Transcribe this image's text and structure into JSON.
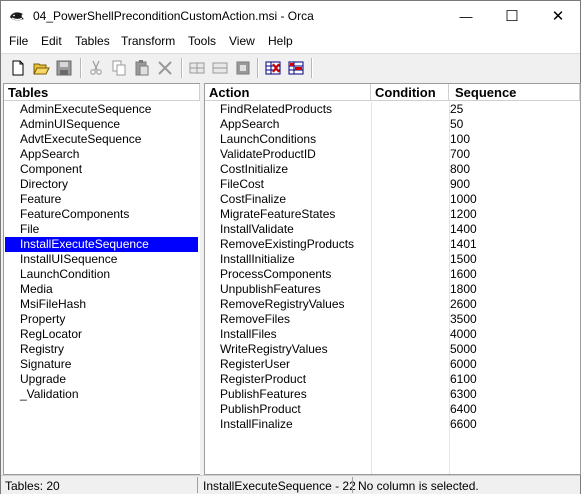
{
  "window": {
    "title": "04_PowerShellPreconditionCustomAction.msi - Orca",
    "controls": {
      "minimize": "—",
      "maximize": "☐",
      "close": "✕"
    }
  },
  "menu": {
    "items": [
      {
        "label": "File"
      },
      {
        "label": "Edit"
      },
      {
        "label": "Tables"
      },
      {
        "label": "Transform"
      },
      {
        "label": "Tools"
      },
      {
        "label": "View"
      },
      {
        "label": "Help"
      }
    ]
  },
  "toolbar": {
    "buttons": [
      "new-icon",
      "open-icon",
      "save-icon",
      "cut-icon",
      "copy-icon",
      "paste-icon",
      "delete-icon",
      "add-row-icon",
      "drop-row-icon",
      "merge-icon",
      "validate-icon",
      "table-icon"
    ]
  },
  "tables_pane": {
    "header": "Tables",
    "selected": "InstallExecuteSequence",
    "items": [
      "AdminExecuteSequence",
      "AdminUISequence",
      "AdvtExecuteSequence",
      "AppSearch",
      "Component",
      "Directory",
      "Feature",
      "FeatureComponents",
      "File",
      "InstallExecuteSequence",
      "InstallUISequence",
      "LaunchCondition",
      "Media",
      "MsiFileHash",
      "Property",
      "RegLocator",
      "Registry",
      "Signature",
      "Upgrade",
      "_Validation"
    ]
  },
  "grid": {
    "columns": [
      "Action",
      "Condition",
      "Sequence"
    ],
    "rows": [
      {
        "action": "FindRelatedProducts",
        "condition": "",
        "sequence": "25"
      },
      {
        "action": "AppSearch",
        "condition": "",
        "sequence": "50"
      },
      {
        "action": "LaunchConditions",
        "condition": "",
        "sequence": "100"
      },
      {
        "action": "ValidateProductID",
        "condition": "",
        "sequence": "700"
      },
      {
        "action": "CostInitialize",
        "condition": "",
        "sequence": "800"
      },
      {
        "action": "FileCost",
        "condition": "",
        "sequence": "900"
      },
      {
        "action": "CostFinalize",
        "condition": "",
        "sequence": "1000"
      },
      {
        "action": "MigrateFeatureStates",
        "condition": "",
        "sequence": "1200"
      },
      {
        "action": "InstallValidate",
        "condition": "",
        "sequence": "1400"
      },
      {
        "action": "RemoveExistingProducts",
        "condition": "",
        "sequence": "1401"
      },
      {
        "action": "InstallInitialize",
        "condition": "",
        "sequence": "1500"
      },
      {
        "action": "ProcessComponents",
        "condition": "",
        "sequence": "1600"
      },
      {
        "action": "UnpublishFeatures",
        "condition": "",
        "sequence": "1800"
      },
      {
        "action": "RemoveRegistryValues",
        "condition": "",
        "sequence": "2600"
      },
      {
        "action": "RemoveFiles",
        "condition": "",
        "sequence": "3500"
      },
      {
        "action": "InstallFiles",
        "condition": "",
        "sequence": "4000"
      },
      {
        "action": "WriteRegistryValues",
        "condition": "",
        "sequence": "5000"
      },
      {
        "action": "RegisterUser",
        "condition": "",
        "sequence": "6000"
      },
      {
        "action": "RegisterProduct",
        "condition": "",
        "sequence": "6100"
      },
      {
        "action": "PublishFeatures",
        "condition": "",
        "sequence": "6300"
      },
      {
        "action": "PublishProduct",
        "condition": "",
        "sequence": "6400"
      },
      {
        "action": "InstallFinalize",
        "condition": "",
        "sequence": "6600"
      }
    ]
  },
  "status": {
    "tables_count": "Tables: 20",
    "current_table": "InstallExecuteSequence - 22",
    "column_info": "No column is selected."
  }
}
